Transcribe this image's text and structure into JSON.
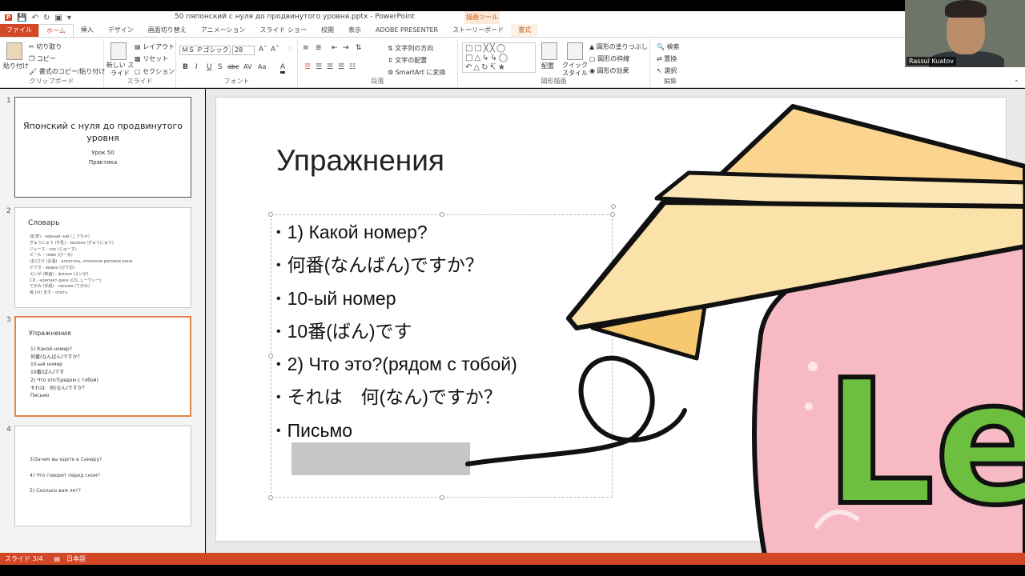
{
  "window": {
    "title": "50 пяпонский с нуля до продвинутого уровня.pptx - PowerPoint",
    "context_tab_label": "描画ツール"
  },
  "tabs": [
    "ファイル",
    "ホーム",
    "挿入",
    "デザイン",
    "画面切り替え",
    "アニメーション",
    "スライド ショー",
    "校閲",
    "表示",
    "ADOBE PRESENTER",
    "ストーリーボード",
    "書式"
  ],
  "ribbon": {
    "clipboard": {
      "paste": "貼り付け",
      "cut": "切り取り",
      "copy": "コピー",
      "format_painter": "書式のコピー/貼り付け",
      "name": "クリップボード"
    },
    "slides": {
      "new_slide": "新しい スライド",
      "layout": "レイアウト",
      "reset": "リセット",
      "section": "セクション",
      "name": "スライド"
    },
    "font": {
      "font_name": "ＭＳ Ｐゴシック",
      "font_size": "28",
      "name": "フォント"
    },
    "paragraph": {
      "text_direction": "文字列の方向",
      "align_text": "文字の配置",
      "smartart": "SmartArt に変換",
      "name": "段落"
    },
    "drawing": {
      "arrange": "配置",
      "quick_styles": "クイック スタイル",
      "shape_fill": "図形の塗りつぶし",
      "shape_outline": "図形の枠線",
      "shape_effects": "図形の効果",
      "name": "図形描画"
    },
    "editing": {
      "find": "検索",
      "replace": "置換",
      "select": "選択",
      "name": "編集"
    }
  },
  "thumbnails": [
    {
      "number": "1",
      "title": "Японский с нуля до продвинутого уровня",
      "sub1": "Урок 50",
      "sub2": "Практика"
    },
    {
      "number": "2",
      "title": "Словарь",
      "items": [
        "(紅茶) - черный чай (こうちゃ)",
        "ぎゅうにゅう (牛乳) - молоко (ぎゅうにゅう)",
        "ジュース - сок (じゅーす)",
        "ビール – пиво (びーる)",
        "(お)さけ (お酒) - алкоголь, японское рисовое вино",
        "ビデオ - видео (びでお)",
        "えいが (映画) - фильм (えいが)",
        "CD - компакт-диск (CD, しーでぃー)",
        "てがみ (手紙) - письмо (てがみ)",
        "吸 (Ｎ) ます - отить"
      ]
    },
    {
      "number": "3",
      "title": "Упражнения",
      "items": [
        "1) Какой номер?",
        "何番(なんばん)ですか？",
        "10-ый номер",
        "10番(ばん)です",
        "2) Что это?(рядом с тобой)",
        "それは　何(なん)ですか？",
        "Письмо"
      ]
    },
    {
      "number": "4",
      "items": [
        "3)Зачем вы едете в Самару?",
        "4) Что говорят перед сном?",
        "5) Сколько вам лет?"
      ]
    }
  ],
  "slide": {
    "title": "Упражнения",
    "bullets": [
      "1) Какой номер?",
      "何番(なんばん)ですか？",
      "10-ый номер",
      "10番(ばん)です",
      "2) Что это?(рядом с тобой)",
      "それは　何(なん)ですか？",
      "Письмо"
    ]
  },
  "status_bar": {
    "slide_counter": "スライド 3/4",
    "language": "日本語"
  },
  "webcam": {
    "name": "Rassul Kuatov"
  },
  "overlay": {
    "text": "Let"
  },
  "colors": {
    "accent": "#d24726",
    "selection": "#e3854a",
    "overlay_pink": "#f7b9c4",
    "overlay_green": "#6cbf3f",
    "plane": "#fbd58f"
  }
}
